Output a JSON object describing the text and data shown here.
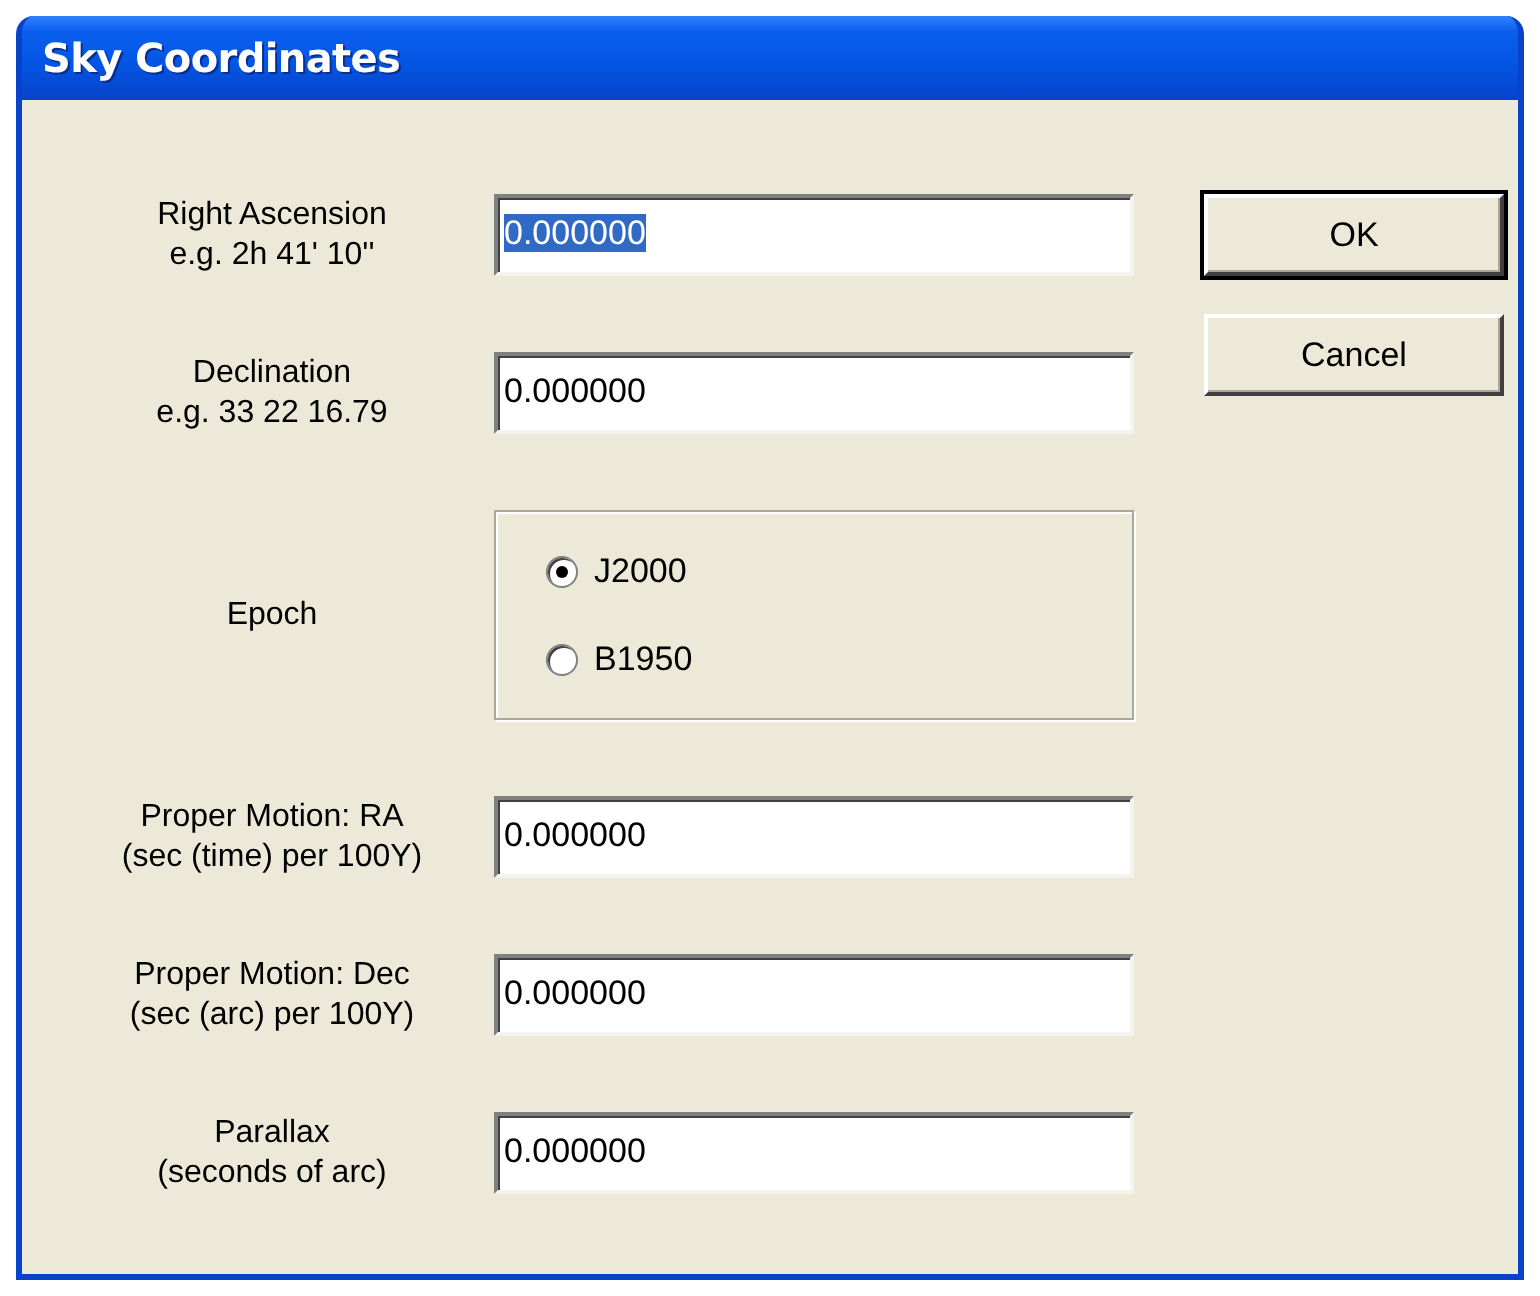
{
  "window": {
    "title": "Sky Coordinates"
  },
  "rows": [
    {
      "kind": "text",
      "label": "Right Ascension",
      "hint": "e.g. 2h 41' 10''",
      "value": "0.000000",
      "value_selected": true
    },
    {
      "kind": "text",
      "label": "Declination",
      "hint": "e.g. 33 22 16.79",
      "value": "0.000000",
      "value_selected": false
    },
    {
      "kind": "radio",
      "label": "Epoch",
      "options": [
        {
          "label": "J2000",
          "selected": true
        },
        {
          "label": "B1950",
          "selected": false
        }
      ]
    },
    {
      "kind": "text",
      "label": "Proper Motion: RA",
      "hint": "(sec (time) per 100Y)",
      "value": "0.000000",
      "value_selected": false
    },
    {
      "kind": "text",
      "label": "Proper Motion: Dec",
      "hint": "(sec (arc) per 100Y)",
      "value": "0.000000",
      "value_selected": false
    },
    {
      "kind": "text",
      "label": "Parallax",
      "hint": "(seconds of arc)",
      "value": "0.000000",
      "value_selected": false
    }
  ],
  "buttons": [
    {
      "label": "OK",
      "default": true
    },
    {
      "label": "Cancel",
      "default": false
    }
  ]
}
